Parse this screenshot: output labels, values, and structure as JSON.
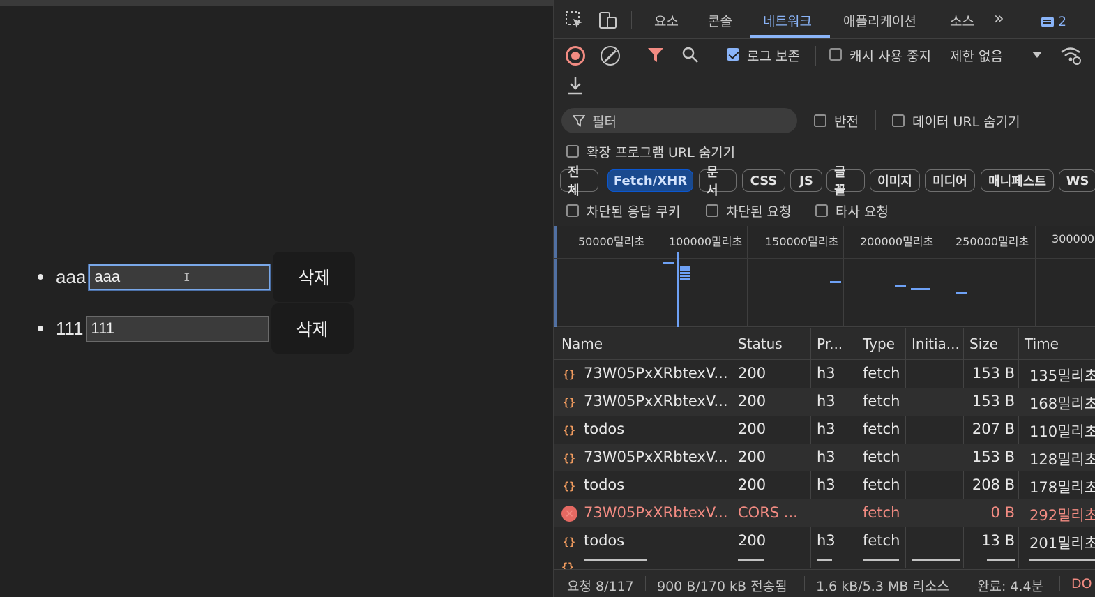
{
  "app": {
    "todos": [
      {
        "label": "aaa",
        "input_value": "aaa",
        "delete_label": "삭제"
      },
      {
        "label": "111",
        "input_value": "111",
        "delete_label": "삭제"
      }
    ]
  },
  "devtools": {
    "tabs": [
      "요소",
      "콘솔",
      "네트워크",
      "애플리케이션",
      "소스"
    ],
    "active_tab": "네트워크",
    "more_tabs": "»",
    "message_count": "2",
    "toolbar": {
      "preserve_log": "로그 보존",
      "disable_cache": "캐시 사용 중지",
      "throttling": "제한 없음"
    },
    "filter": {
      "placeholder": "필터",
      "invert": "반전",
      "hide_data_urls": "데이터 URL 숨기기",
      "hide_extension_urls": "확장 프로그램 URL 숨기기",
      "chips": [
        "전체",
        "Fetch/XHR",
        "문서",
        "CSS",
        "JS",
        "글꼴",
        "이미지",
        "미디어",
        "매니페스트",
        "WS"
      ],
      "active_chip": "Fetch/XHR",
      "blocked_cookies": "차단된 응답 쿠키",
      "blocked_requests": "차단된 요청",
      "third_party": "타사 요청"
    },
    "timeline_ticks": [
      "50000밀리초",
      "100000밀리초",
      "150000밀리초",
      "200000밀리초",
      "250000밀리초",
      "300000"
    ],
    "columns": [
      "Name",
      "Status",
      "Pr...",
      "Type",
      "Initia...",
      "Size",
      "Time"
    ],
    "rows": [
      {
        "name": "73W05PxXRbtexV...",
        "status": "200",
        "protocol": "h3",
        "type": "fetch",
        "size": "153 B",
        "time": "135밀리초",
        "error": false
      },
      {
        "name": "73W05PxXRbtexV...",
        "status": "200",
        "protocol": "h3",
        "type": "fetch",
        "size": "153 B",
        "time": "168밀리초",
        "error": false
      },
      {
        "name": "todos",
        "status": "200",
        "protocol": "h3",
        "type": "fetch",
        "size": "207 B",
        "time": "110밀리초",
        "error": false
      },
      {
        "name": "73W05PxXRbtexV...",
        "status": "200",
        "protocol": "h3",
        "type": "fetch",
        "size": "153 B",
        "time": "128밀리초",
        "error": false
      },
      {
        "name": "todos",
        "status": "200",
        "protocol": "h3",
        "type": "fetch",
        "size": "208 B",
        "time": "178밀리초",
        "error": false
      },
      {
        "name": "73W05PxXRbtexV...",
        "status": "CORS ...",
        "protocol": "",
        "type": "fetch",
        "size": "0 B",
        "time": "292밀리초",
        "error": true
      },
      {
        "name": "todos",
        "status": "200",
        "protocol": "h3",
        "type": "fetch",
        "size": "13 B",
        "time": "201밀리초",
        "error": false
      }
    ],
    "statusbar": {
      "requests": "요청 8/117",
      "transferred": "900 B/170 kB 전송됨",
      "resources": "1.6 kB/5.3 MB 리소스",
      "finish": "완료: 4.4분",
      "dom": "DO"
    }
  }
}
